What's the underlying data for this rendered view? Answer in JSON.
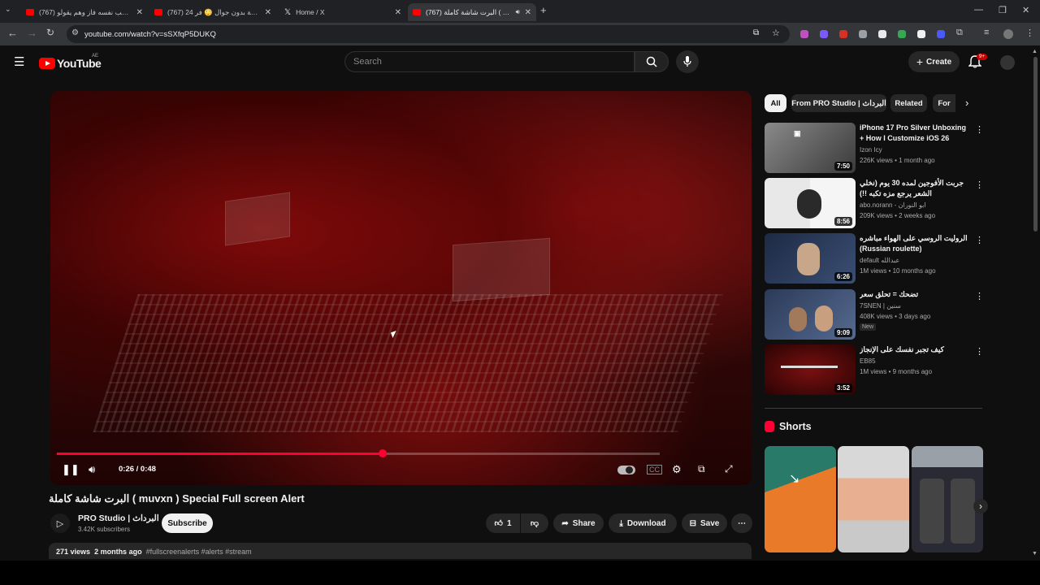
{
  "browser": {
    "tabs": [
      {
        "title": "(767) يحسب نفسه فاز وهم يقولو",
        "active": false
      },
      {
        "title": "(767) 24 ساعة بدون جوال 😳 فر",
        "active": false
      },
      {
        "title": "Home / X",
        "active": false
      },
      {
        "title": "(767) البرت شاشة كاملة ( muvxn",
        "active": true
      }
    ],
    "url": "youtube.com/watch?v=sSXfqP5DUKQ"
  },
  "header": {
    "logo_text": "YouTube",
    "country_code": "AE",
    "search_placeholder": "Search",
    "create_label": "Create",
    "notification_badge": "9+"
  },
  "player": {
    "current_time": "0:26",
    "duration": "0:48",
    "time_display": "0:26 / 0:48",
    "progress_fraction": 0.54
  },
  "video": {
    "title": "البرت شاشة كاملة ( muvxn ) Special Full screen Alert",
    "channel_name": "PRO Studio | البرداث",
    "subscribers": "3.42K subscribers",
    "subscribe_label": "Subscribe",
    "likes": "1",
    "share_label": "Share",
    "download_label": "Download",
    "save_label": "Save",
    "views": "271 views",
    "age": "2 months ago",
    "hashtags": "#fullscreenalerts #alerts #stream"
  },
  "chips": [
    "All",
    "From PRO Studio | البرداث",
    "Related",
    "For"
  ],
  "recommendations": [
    {
      "title": "iPhone 17 Pro Silver Unboxing + How I Customize iOS 26",
      "channel": "Izon Icy",
      "meta": "226K views • 1 month ago",
      "duration": "7:50",
      "thumb_color": "#6b6b6b"
    },
    {
      "title": "جربت الأفوجين لمده 30 يوم (نخلي الشعر يرجع مزه تكبه !!)",
      "channel": "abo.norann - ابو النوران",
      "meta": "209K views • 2 weeks ago",
      "duration": "8:56",
      "thumb_color": "#d9d9d9"
    },
    {
      "title": "الروليت الروسي على الهواء مباشره (Russian roulette)",
      "channel": "default ‎عبدالله",
      "meta": "1M views • 10 months ago",
      "duration": "6:26",
      "thumb_color": "#2a3a55"
    },
    {
      "title": "تضحك = تحلق سعر",
      "channel": "7SNEN | سنين",
      "meta": "408K views • 3 days ago",
      "duration": "9:09",
      "thumb_color": "#3a4a66",
      "badge": "New"
    },
    {
      "title": "كيف تجبر نفسك على الإنجاز",
      "channel": "EB85",
      "meta": "1M views • 9 months ago",
      "duration": "3:52",
      "thumb_color": "#4a0d0d"
    }
  ],
  "shorts": {
    "heading": "Shorts",
    "items": [
      {
        "color": "#e87a2a"
      },
      {
        "color": "#e8b090"
      },
      {
        "color": "#3a3a44"
      }
    ]
  },
  "colors": {
    "accent": "#ff0033",
    "background": "#0f0f0f",
    "pill": "#272727"
  }
}
